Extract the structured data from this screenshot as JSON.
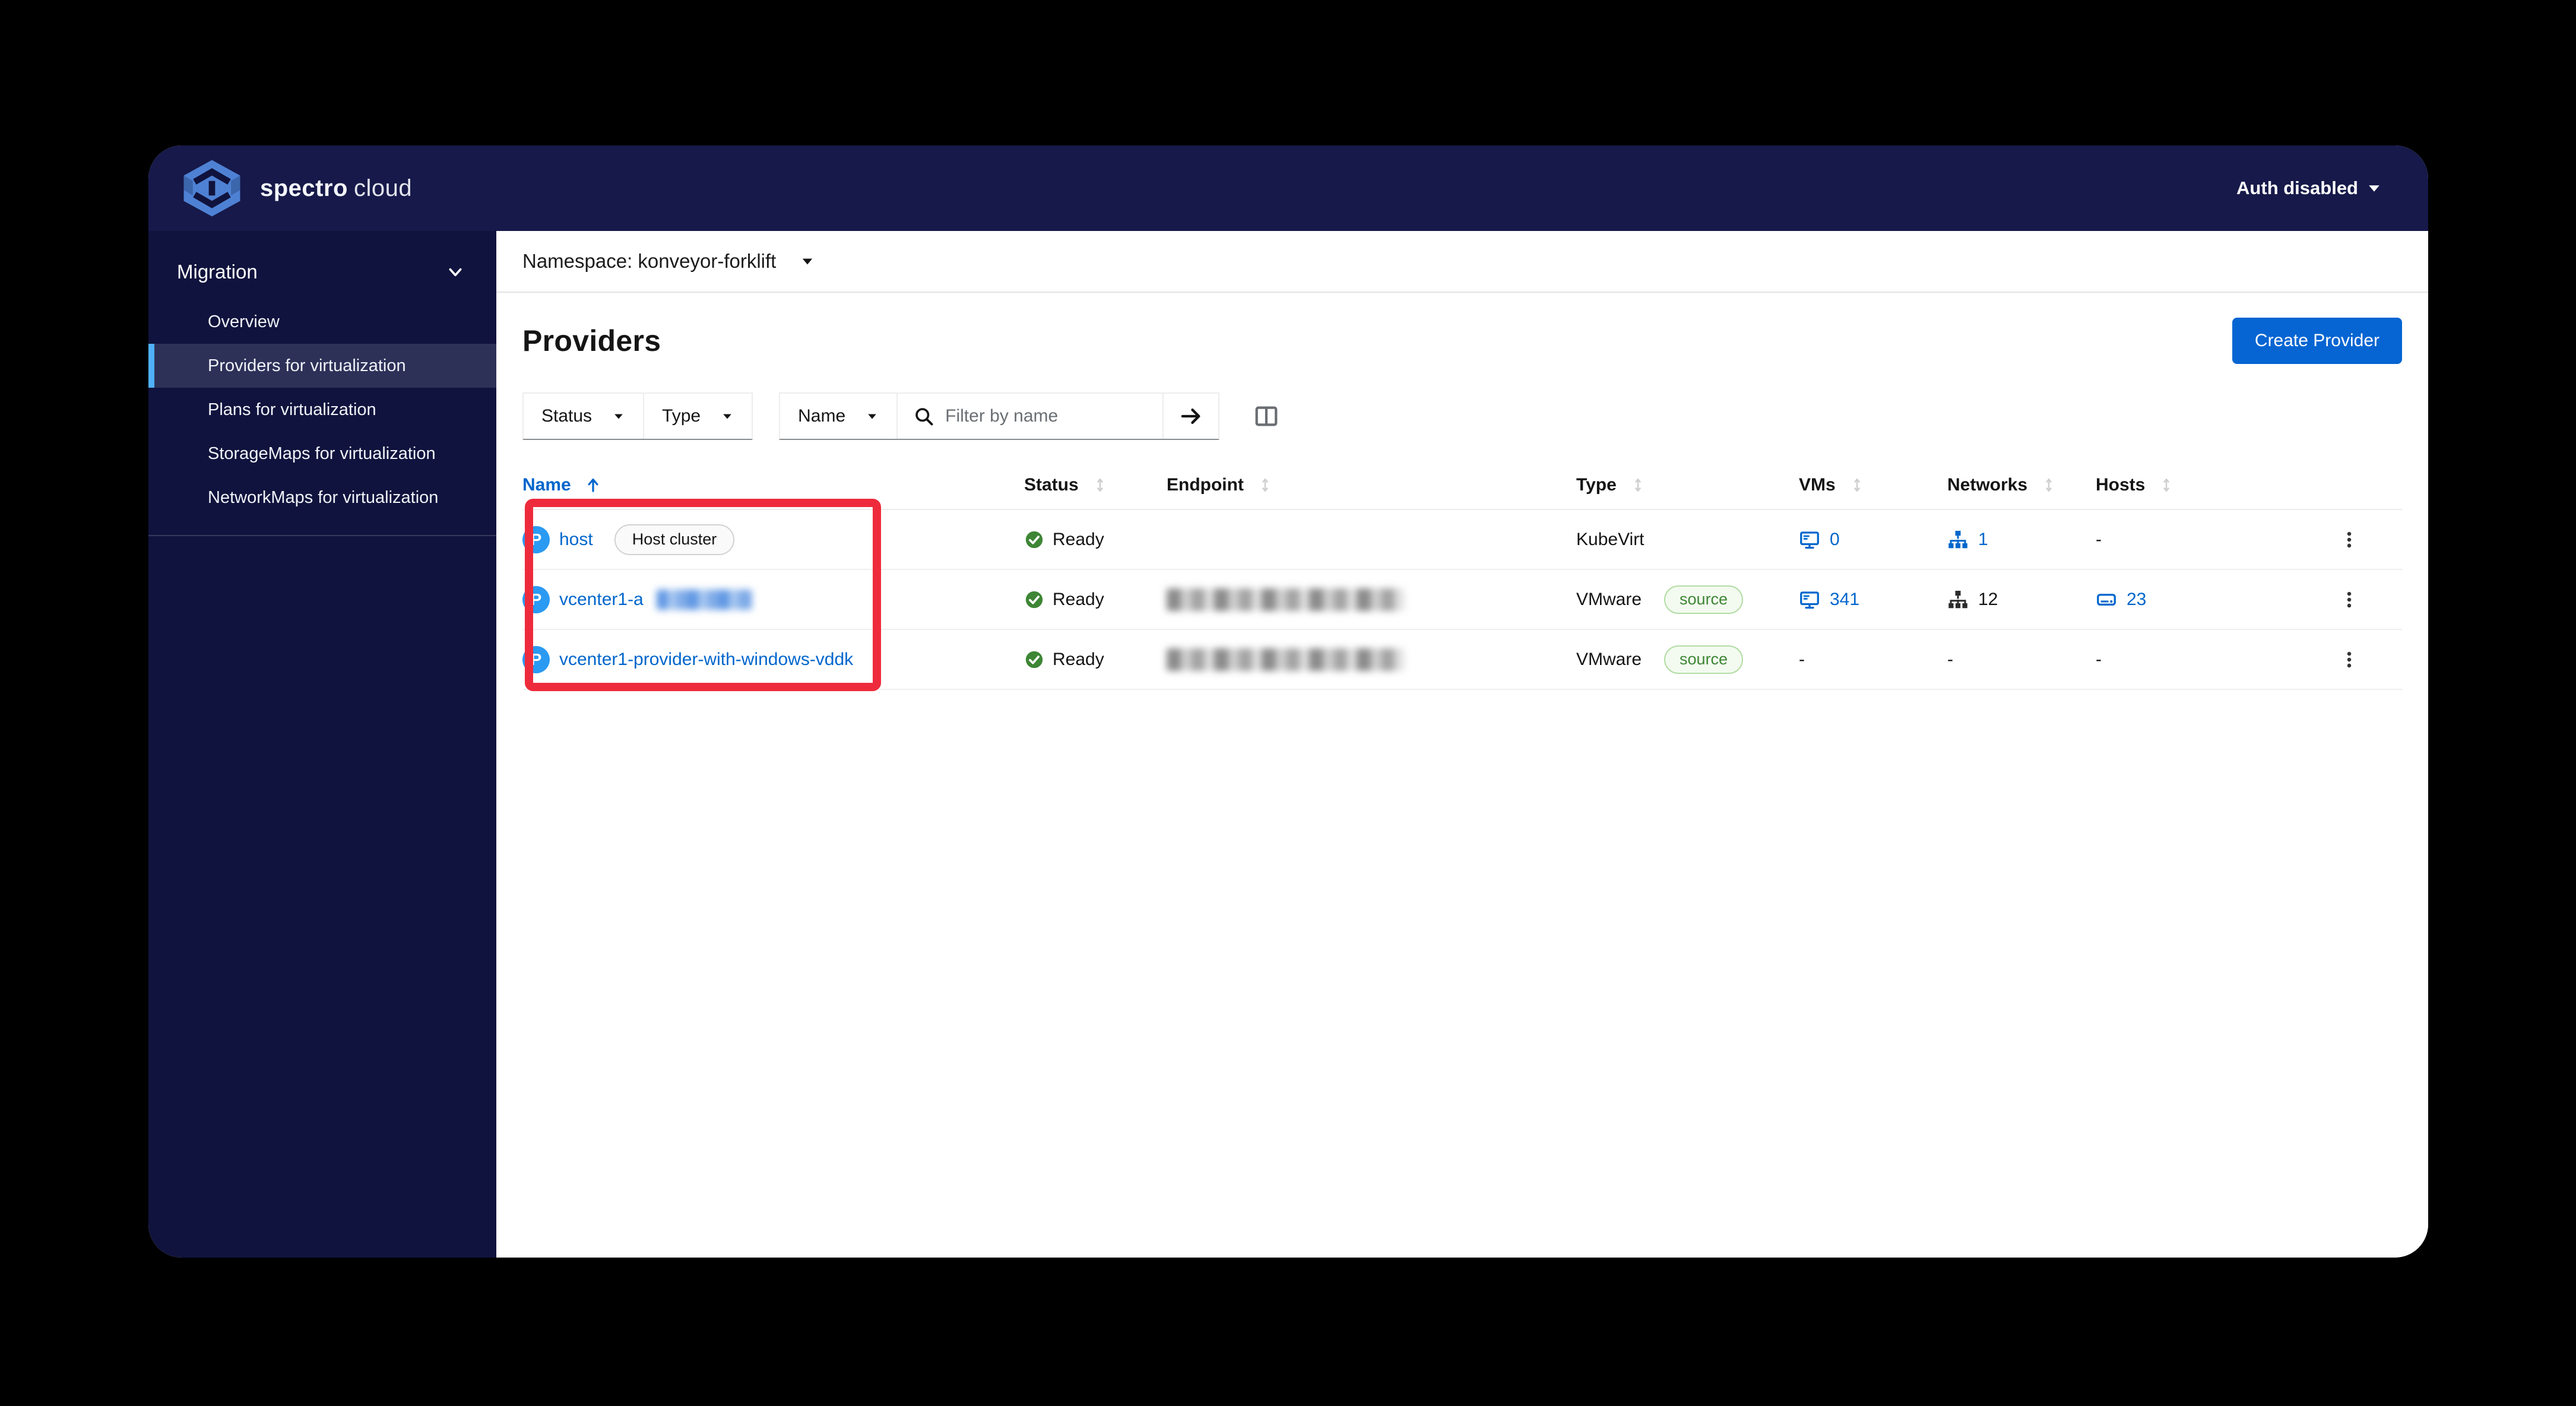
{
  "masthead": {
    "brand_bold": "spectro",
    "brand_light": "cloud",
    "auth_label": "Auth disabled"
  },
  "sidebar": {
    "group_label": "Migration",
    "items": [
      {
        "label": "Overview",
        "selected": false
      },
      {
        "label": "Providers for virtualization",
        "selected": true
      },
      {
        "label": "Plans for virtualization",
        "selected": false
      },
      {
        "label": "StorageMaps for virtualization",
        "selected": false
      },
      {
        "label": "NetworkMaps for virtualization",
        "selected": false
      }
    ]
  },
  "namespace_bar": {
    "label": "Namespace: konveyor-forklift"
  },
  "page": {
    "title": "Providers",
    "create_button": "Create Provider"
  },
  "toolbar": {
    "status_filter": "Status",
    "type_filter": "Type",
    "name_filter": "Name",
    "search_placeholder": "Filter by name"
  },
  "table": {
    "columns": [
      "Name",
      "Status",
      "Endpoint",
      "Type",
      "VMs",
      "Networks",
      "Hosts"
    ],
    "sorted_column": "Name",
    "sort_direction": "ascending",
    "rows": [
      {
        "name": "host",
        "name_badge": "Host cluster",
        "status": "Ready",
        "endpoint": "",
        "type": "KubeVirt",
        "type_badge": "",
        "vms": "0",
        "networks": "1",
        "hosts": "-"
      },
      {
        "name": "vcenter1-a",
        "name_redacted": true,
        "status": "Ready",
        "endpoint_redacted": true,
        "type": "VMware",
        "type_badge": "source",
        "vms": "341",
        "networks": "12",
        "hosts": "23"
      },
      {
        "name": "vcenter1-provider-with-windows-vddk",
        "status": "Ready",
        "endpoint_redacted": true,
        "type": "VMware",
        "type_badge": "source",
        "vms": "-",
        "networks": "-",
        "hosts": "-"
      }
    ]
  },
  "annotation": {
    "shape": "rectangle",
    "color": "#ee2b3c",
    "around": "Name column cells"
  },
  "colors": {
    "masthead_bg": "#161949",
    "sidebar_bg": "#10133d",
    "selected_nav_bg": "#2d3158",
    "nav_accent": "#4fb1f7",
    "link_blue": "#0066cc",
    "primary_button": "#0665d2",
    "ready_green": "#3e8635",
    "provider_icon_blue": "#2b9af3",
    "annotation_red": "#ee2b3c"
  }
}
